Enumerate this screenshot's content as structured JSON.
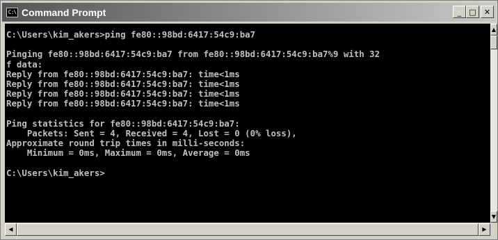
{
  "window": {
    "title": "Command Prompt",
    "icon": "console-icon",
    "icon_text": "C:\\",
    "controls": {
      "minimize": "_",
      "maximize": "□",
      "close": "✕"
    }
  },
  "console": {
    "text_color": "#c0c0c0",
    "background": "#000000",
    "lines": [
      "C:\\Users\\kim_akers>ping fe80::98bd:6417:54c9:ba7",
      "",
      "Pinging fe80::98bd:6417:54c9:ba7 from fe80::98bd:6417:54c9:ba7%9 with 32",
      "f data:",
      "Reply from fe80::98bd:6417:54c9:ba7: time<1ms",
      "Reply from fe80::98bd:6417:54c9:ba7: time<1ms",
      "Reply from fe80::98bd:6417:54c9:ba7: time<1ms",
      "Reply from fe80::98bd:6417:54c9:ba7: time<1ms",
      "",
      "Ping statistics for fe80::98bd:6417:54c9:ba7:",
      "    Packets: Sent = 4, Received = 4, Lost = 0 (0% loss),",
      "Approximate round trip times in milli-seconds:",
      "    Minimum = 0ms, Maximum = 0ms, Average = 0ms",
      "",
      "C:\\Users\\kim_akers>"
    ]
  },
  "scrollbars": {
    "up_arrow": "▲",
    "down_arrow": "▼",
    "left_arrow": "◀",
    "right_arrow": "▶"
  }
}
